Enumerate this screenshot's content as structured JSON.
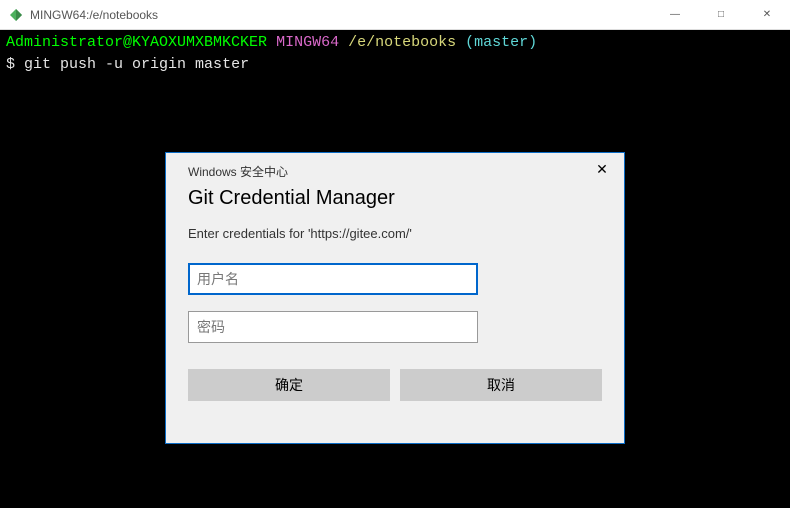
{
  "window": {
    "title": "MINGW64:/e/notebooks"
  },
  "terminal": {
    "user": "Administrator@KYAOXUMXBMKCKER",
    "env": "MINGW64",
    "path": "/e/notebooks",
    "branch": "(master)",
    "prompt": "$",
    "command": "git push -u origin master"
  },
  "dialog": {
    "header": "Windows 安全中心",
    "title": "Git Credential Manager",
    "message": "Enter credentials for 'https://gitee.com/'",
    "username_placeholder": "用户名",
    "password_placeholder": "密码",
    "ok_label": "确定",
    "cancel_label": "取消",
    "close_glyph": "✕"
  },
  "win_controls": {
    "min": "—",
    "max": "□",
    "close": "✕"
  }
}
